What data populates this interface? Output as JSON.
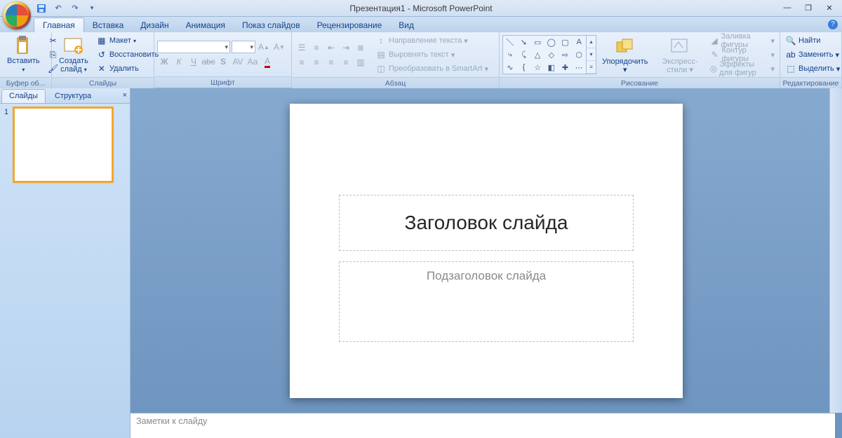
{
  "title": "Презентация1 - Microsoft PowerPoint",
  "qat": {
    "save": "save",
    "undo": "undo",
    "redo": "redo"
  },
  "win": {
    "min": "—",
    "max": "❐",
    "close": "✕"
  },
  "tabs": {
    "home": "Главная",
    "insert": "Вставка",
    "design": "Дизайн",
    "anim": "Анимация",
    "show": "Показ слайдов",
    "review": "Рецензирование",
    "view": "Вид"
  },
  "groups": {
    "clipboard": {
      "label": "Буфер об...",
      "paste": "Вставить"
    },
    "slides": {
      "label": "Слайды",
      "new": "Создать\nслайд",
      "layout": "Макет",
      "reset": "Восстановить",
      "delete": "Удалить"
    },
    "font": {
      "label": "Шрифт",
      "family": "",
      "size": ""
    },
    "paragraph": {
      "label": "Абзац",
      "dir": "Направление текста",
      "align": "Выровнять текст",
      "smartart": "Преобразовать в SmartArt"
    },
    "drawing": {
      "label": "Рисование",
      "arrange": "Упорядочить",
      "styles": "Экспресс-стили",
      "fill": "Заливка фигуры",
      "outline": "Контур фигуры",
      "effects": "Эффекты для фигур"
    },
    "editing": {
      "label": "Редактирование",
      "find": "Найти",
      "replace": "Заменить",
      "select": "Выделить"
    }
  },
  "sidebar": {
    "tab_slides": "Слайды",
    "tab_outline": "Структура",
    "slide_num": "1"
  },
  "slide": {
    "title": "Заголовок слайда",
    "subtitle": "Подзаголовок слайда"
  },
  "notes": {
    "placeholder": "Заметки к слайду"
  }
}
